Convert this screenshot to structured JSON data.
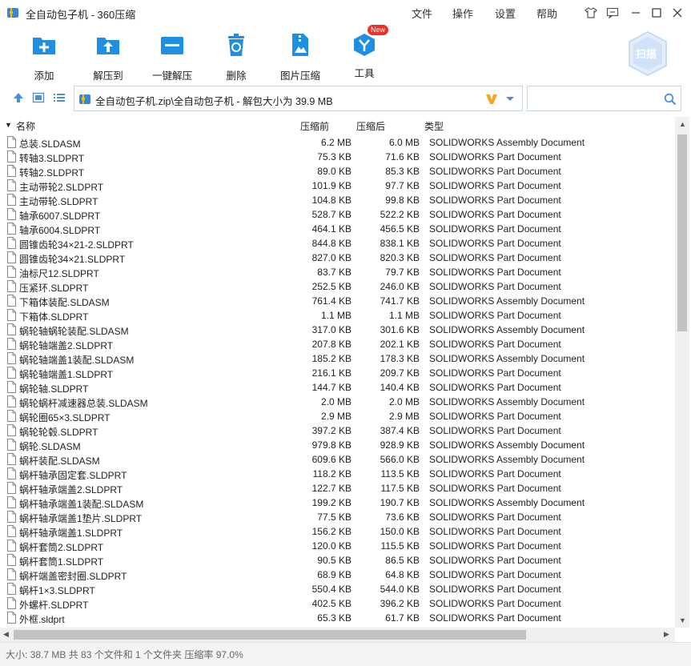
{
  "window": {
    "title": "全自动包子机 - 360压缩"
  },
  "menu": {
    "file": "文件",
    "operate": "操作",
    "settings": "设置",
    "help": "帮助"
  },
  "toolbar": {
    "add": "添加",
    "extract_to": "解压到",
    "one_click_extract": "一键解压",
    "delete": "删除",
    "image_compress": "图片压缩",
    "tools": "工具",
    "tools_badge": "New",
    "scan": "扫描"
  },
  "address": {
    "path": "全自动包子机.zip\\全自动包子机 - 解包大小为 39.9 MB",
    "search_placeholder": ""
  },
  "columns": {
    "name": "名称",
    "before": "压缩前",
    "after": "压缩后",
    "type": "类型"
  },
  "files": [
    {
      "name": "总装.SLDASM",
      "before": "6.2 MB",
      "after": "6.0 MB",
      "type": "SOLIDWORKS Assembly Document"
    },
    {
      "name": "转轴3.SLDPRT",
      "before": "75.3 KB",
      "after": "71.6 KB",
      "type": "SOLIDWORKS Part Document"
    },
    {
      "name": "转轴2.SLDPRT",
      "before": "89.0 KB",
      "after": "85.3 KB",
      "type": "SOLIDWORKS Part Document"
    },
    {
      "name": "主动带轮2.SLDPRT",
      "before": "101.9 KB",
      "after": "97.7 KB",
      "type": "SOLIDWORKS Part Document"
    },
    {
      "name": "主动带轮.SLDPRT",
      "before": "104.8 KB",
      "after": "99.8 KB",
      "type": "SOLIDWORKS Part Document"
    },
    {
      "name": "轴承6007.SLDPRT",
      "before": "528.7 KB",
      "after": "522.2 KB",
      "type": "SOLIDWORKS Part Document"
    },
    {
      "name": "轴承6004.SLDPRT",
      "before": "464.1 KB",
      "after": "456.5 KB",
      "type": "SOLIDWORKS Part Document"
    },
    {
      "name": "圆锥齿轮34×21-2.SLDPRT",
      "before": "844.8 KB",
      "after": "838.1 KB",
      "type": "SOLIDWORKS Part Document"
    },
    {
      "name": "圆锥齿轮34×21.SLDPRT",
      "before": "827.0 KB",
      "after": "820.3 KB",
      "type": "SOLIDWORKS Part Document"
    },
    {
      "name": "油标尺12.SLDPRT",
      "before": "83.7 KB",
      "after": "79.7 KB",
      "type": "SOLIDWORKS Part Document"
    },
    {
      "name": "压紧环.SLDPRT",
      "before": "252.5 KB",
      "after": "246.0 KB",
      "type": "SOLIDWORKS Part Document"
    },
    {
      "name": "下箱体装配.SLDASM",
      "before": "761.4 KB",
      "after": "741.7 KB",
      "type": "SOLIDWORKS Assembly Document"
    },
    {
      "name": "下箱体.SLDPRT",
      "before": "1.1 MB",
      "after": "1.1 MB",
      "type": "SOLIDWORKS Part Document"
    },
    {
      "name": "蜗轮轴蜗轮装配.SLDASM",
      "before": "317.0 KB",
      "after": "301.6 KB",
      "type": "SOLIDWORKS Assembly Document"
    },
    {
      "name": "蜗轮轴端盖2.SLDPRT",
      "before": "207.8 KB",
      "after": "202.1 KB",
      "type": "SOLIDWORKS Part Document"
    },
    {
      "name": "蜗轮轴端盖1装配.SLDASM",
      "before": "185.2 KB",
      "after": "178.3 KB",
      "type": "SOLIDWORKS Assembly Document"
    },
    {
      "name": "蜗轮轴端盖1.SLDPRT",
      "before": "216.1 KB",
      "after": "209.7 KB",
      "type": "SOLIDWORKS Part Document"
    },
    {
      "name": "蜗轮轴.SLDPRT",
      "before": "144.7 KB",
      "after": "140.4 KB",
      "type": "SOLIDWORKS Part Document"
    },
    {
      "name": "蜗轮蜗杆减速器总装.SLDASM",
      "before": "2.0 MB",
      "after": "2.0 MB",
      "type": "SOLIDWORKS Assembly Document"
    },
    {
      "name": "蜗轮圈65×3.SLDPRT",
      "before": "2.9 MB",
      "after": "2.9 MB",
      "type": "SOLIDWORKS Part Document"
    },
    {
      "name": "蜗轮轮毂.SLDPRT",
      "before": "397.2 KB",
      "after": "387.4 KB",
      "type": "SOLIDWORKS Part Document"
    },
    {
      "name": "蜗轮.SLDASM",
      "before": "979.8 KB",
      "after": "928.9 KB",
      "type": "SOLIDWORKS Assembly Document"
    },
    {
      "name": "蜗杆装配.SLDASM",
      "before": "609.6 KB",
      "after": "566.0 KB",
      "type": "SOLIDWORKS Assembly Document"
    },
    {
      "name": "蜗杆轴承固定套.SLDPRT",
      "before": "118.2 KB",
      "after": "113.5 KB",
      "type": "SOLIDWORKS Part Document"
    },
    {
      "name": "蜗杆轴承端盖2.SLDPRT",
      "before": "122.7 KB",
      "after": "117.5 KB",
      "type": "SOLIDWORKS Part Document"
    },
    {
      "name": "蜗杆轴承端盖1装配.SLDASM",
      "before": "199.2 KB",
      "after": "190.7 KB",
      "type": "SOLIDWORKS Assembly Document"
    },
    {
      "name": "蜗杆轴承端盖1垫片.SLDPRT",
      "before": "77.5 KB",
      "after": "73.6 KB",
      "type": "SOLIDWORKS Part Document"
    },
    {
      "name": "蜗杆轴承端盖1.SLDPRT",
      "before": "156.2 KB",
      "after": "150.0 KB",
      "type": "SOLIDWORKS Part Document"
    },
    {
      "name": "蜗杆套筒2.SLDPRT",
      "before": "120.0 KB",
      "after": "115.5 KB",
      "type": "SOLIDWORKS Part Document"
    },
    {
      "name": "蜗杆套筒1.SLDPRT",
      "before": "90.5 KB",
      "after": "86.5 KB",
      "type": "SOLIDWORKS Part Document"
    },
    {
      "name": "蜗杆端盖密封圈.SLDPRT",
      "before": "68.9 KB",
      "after": "64.8 KB",
      "type": "SOLIDWORKS Part Document"
    },
    {
      "name": "蜗杆1×3.SLDPRT",
      "before": "550.4 KB",
      "after": "544.0 KB",
      "type": "SOLIDWORKS Part Document"
    },
    {
      "name": "外螺杆.SLDPRT",
      "before": "402.5 KB",
      "after": "396.2 KB",
      "type": "SOLIDWORKS Part Document"
    },
    {
      "name": "外框.sldprt",
      "before": "65.3 KB",
      "after": "61.7 KB",
      "type": "SOLIDWORKS Part Document"
    }
  ],
  "status": {
    "text": "大小: 38.7 MB 共 83 个文件和 1 个文件夹 压缩率 97.0%"
  },
  "colors": {
    "accent": "#1e8fe1",
    "badge": "#e8322a",
    "vip": "#f5a623"
  }
}
